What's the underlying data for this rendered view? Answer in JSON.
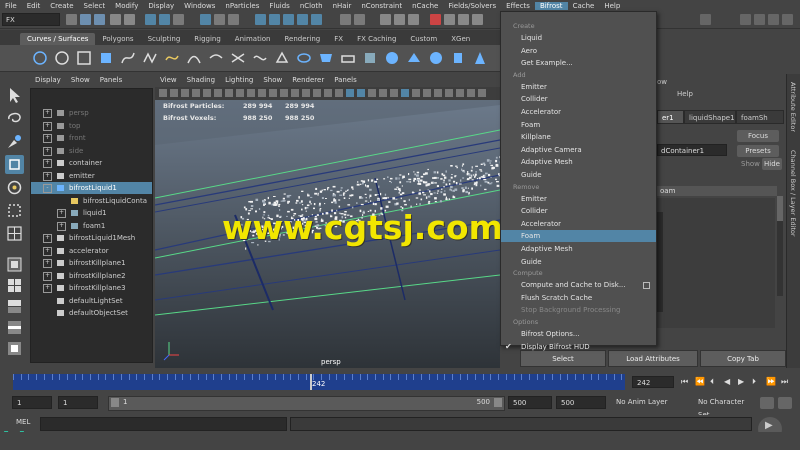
{
  "menubar": [
    "File",
    "Edit",
    "Create",
    "Select",
    "Modify",
    "Display",
    "Windows",
    "nParticles",
    "Fluids",
    "nCloth",
    "nHair",
    "nConstraint",
    "nCache",
    "Fields/Solvers",
    "Effects",
    "Bifrost",
    "Cache",
    "Help"
  ],
  "menubar_active": "Bifrost",
  "status": {
    "mode": "FX"
  },
  "shelf": {
    "tabs": [
      "Curves / Surfaces",
      "Polygons",
      "Sculpting",
      "Rigging",
      "Animation",
      "Rendering",
      "FX",
      "FX Caching",
      "Custom",
      "XGen"
    ],
    "active_tab": "Curves / Surfaces"
  },
  "outliner": {
    "menu": [
      "Display",
      "Show",
      "Panels"
    ],
    "rows": [
      {
        "label": "persp",
        "dim": true,
        "expand": "+",
        "indent": 0,
        "icon": "camera-icon"
      },
      {
        "label": "top",
        "dim": true,
        "expand": "+",
        "indent": 0,
        "icon": "camera-icon"
      },
      {
        "label": "front",
        "dim": true,
        "expand": "+",
        "indent": 0,
        "icon": "camera-icon"
      },
      {
        "label": "side",
        "dim": true,
        "expand": "+",
        "indent": 0,
        "icon": "camera-icon"
      },
      {
        "label": "container",
        "dim": false,
        "expand": "+",
        "indent": 0,
        "icon": "transform-icon"
      },
      {
        "label": "emitter",
        "dim": false,
        "expand": "+",
        "indent": 0,
        "icon": "transform-icon"
      },
      {
        "label": "bifrostLiquid1",
        "dim": false,
        "expand": "-",
        "indent": 0,
        "icon": "liquid-icon",
        "selected": true
      },
      {
        "label": "bifrostLiquidConta",
        "dim": false,
        "expand": "",
        "indent": 1,
        "icon": "container-icon"
      },
      {
        "label": "liquid1",
        "dim": false,
        "expand": "+",
        "indent": 1,
        "icon": "mesh-icon"
      },
      {
        "label": "foam1",
        "dim": false,
        "expand": "+",
        "indent": 1,
        "icon": "mesh-icon"
      },
      {
        "label": "bifrostLiquid1Mesh",
        "dim": false,
        "expand": "+",
        "indent": 0,
        "icon": "transform-icon"
      },
      {
        "label": "accelerator",
        "dim": false,
        "expand": "+",
        "indent": 0,
        "icon": "transform-icon"
      },
      {
        "label": "bifrostKillplane1",
        "dim": false,
        "expand": "+",
        "indent": 0,
        "icon": "transform-icon"
      },
      {
        "label": "bifrostKillplane2",
        "dim": false,
        "expand": "+",
        "indent": 0,
        "icon": "transform-icon"
      },
      {
        "label": "bifrostKillplane3",
        "dim": false,
        "expand": "+",
        "indent": 0,
        "icon": "transform-icon"
      },
      {
        "label": "defaultLightSet",
        "dim": false,
        "expand": "",
        "indent": 0,
        "icon": "set-icon"
      },
      {
        "label": "defaultObjectSet",
        "dim": false,
        "expand": "",
        "indent": 0,
        "icon": "set-icon"
      }
    ]
  },
  "viewport": {
    "menu": [
      "View",
      "Shading",
      "Lighting",
      "Show",
      "Renderer",
      "Panels"
    ],
    "hud": {
      "particles_label": "Bifrost Particles:",
      "particles_a": "289 994",
      "particles_b": "289 994",
      "voxels_label": "Bifrost Voxels:",
      "voxels_a": "988 250",
      "voxels_b": "988 250"
    },
    "camera_label": "persp",
    "watermark": "www.cgtsj.com"
  },
  "bifrost_menu": {
    "sections": [
      {
        "title": "Create",
        "items": [
          "Liquid",
          "Aero",
          "Get Example..."
        ]
      },
      {
        "title": "Add",
        "items": [
          "Emitter",
          "Collider",
          "Accelerator",
          "Foam",
          "Killplane",
          "Adaptive Camera",
          "Adaptive Mesh",
          "Guide"
        ]
      },
      {
        "title": "Remove",
        "items": [
          "Emitter",
          "Collider",
          "Accelerator",
          "Foam",
          "Adaptive Mesh",
          "Guide"
        ]
      },
      {
        "title": "Compute",
        "items": [
          "Compute and Cache to Disk...",
          "Flush Scratch Cache",
          "Stop Background Processing"
        ]
      },
      {
        "title": "Options",
        "items": [
          "Bifrost Options...",
          "Display Bifrost HUD"
        ]
      }
    ],
    "highlighted": "Foam"
  },
  "attribute_editor": {
    "menu_partial": "ow",
    "help": "Help",
    "tabs": [
      "er1",
      "liquidShape1",
      "foamSh"
    ],
    "node_field": "dContainer1",
    "focus": "Focus",
    "presets": "Presets",
    "show": "Show",
    "hide": "Hide",
    "section": "oam",
    "side_labels": [
      "Attribute Editor",
      "Channel Box / Layer Editor"
    ],
    "buttons": [
      "Select",
      "Load Attributes",
      "Copy Tab"
    ]
  },
  "timeline": {
    "current_frame": "242",
    "current_frame_field": "242"
  },
  "range": {
    "start": "1",
    "start2": "1",
    "slider_start": "1",
    "slider_end": "500",
    "end": "500",
    "end2": "500",
    "anim_layer": "No Anim Layer",
    "char_set": "No Character Set"
  },
  "cmdline": {
    "label": "MEL"
  },
  "colors": {
    "accent": "#5285a6",
    "timebar": "#1f3f8d",
    "menu_bg": "#505050"
  }
}
